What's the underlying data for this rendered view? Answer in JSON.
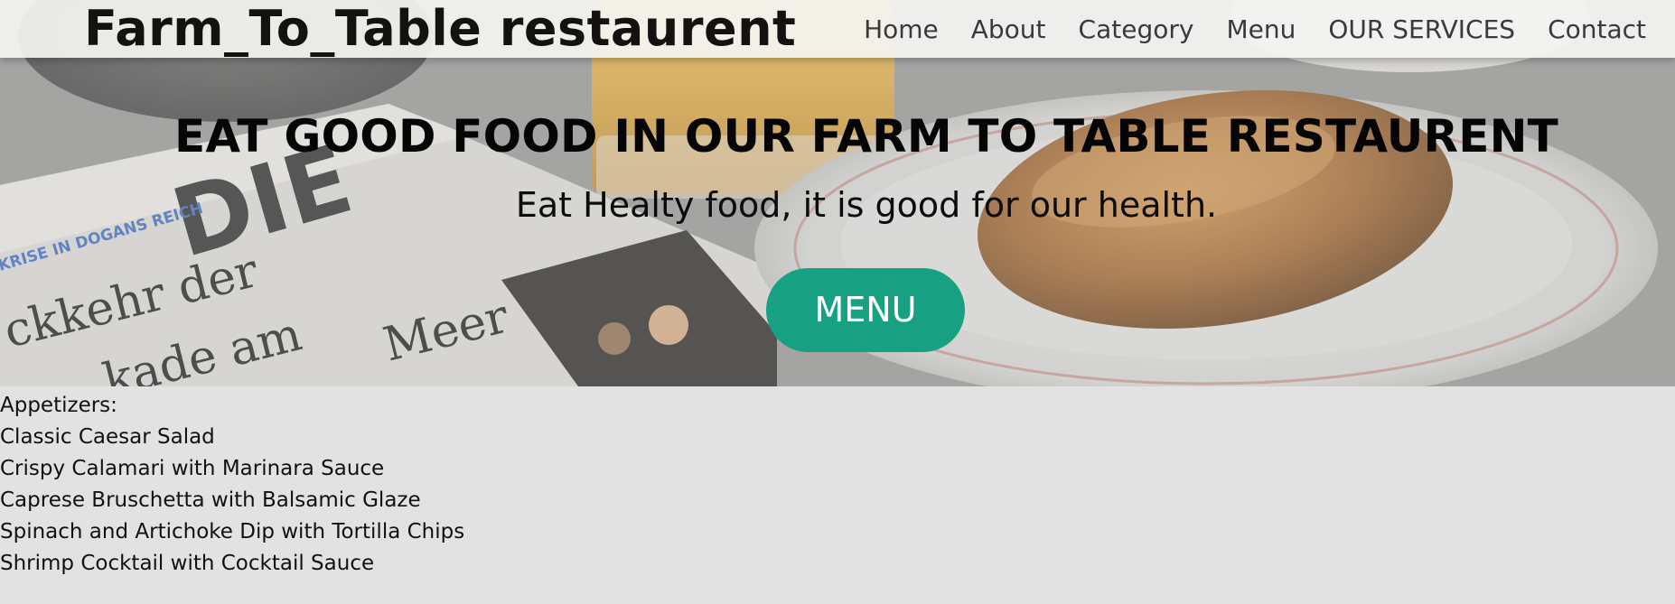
{
  "navbar": {
    "brand": "Farm_To_Table restaurent",
    "links": [
      "Home",
      "About",
      "Category",
      "Menu",
      "OUR SERVICES",
      "Contact"
    ]
  },
  "hero": {
    "title": "EAT GOOD FOOD IN OUR FARM TO TABLE RESTAURENT",
    "subtitle": "Eat Healty food, it is good for our health.",
    "button_label": "MENU"
  },
  "menu": {
    "heading": "Appetizers:",
    "items": [
      "Classic Caesar Salad",
      "Crispy Calamari with Marinara Sauce",
      "Caprese Bruschetta with Balsamic Glaze",
      "Spinach and Artichoke Dip with Tortilla Chips",
      "Shrimp Cocktail with Cocktail Sauce"
    ]
  },
  "colors": {
    "accent": "#17a082",
    "navbar": "#f4f4f2",
    "page_background": "#e2e2e2"
  }
}
